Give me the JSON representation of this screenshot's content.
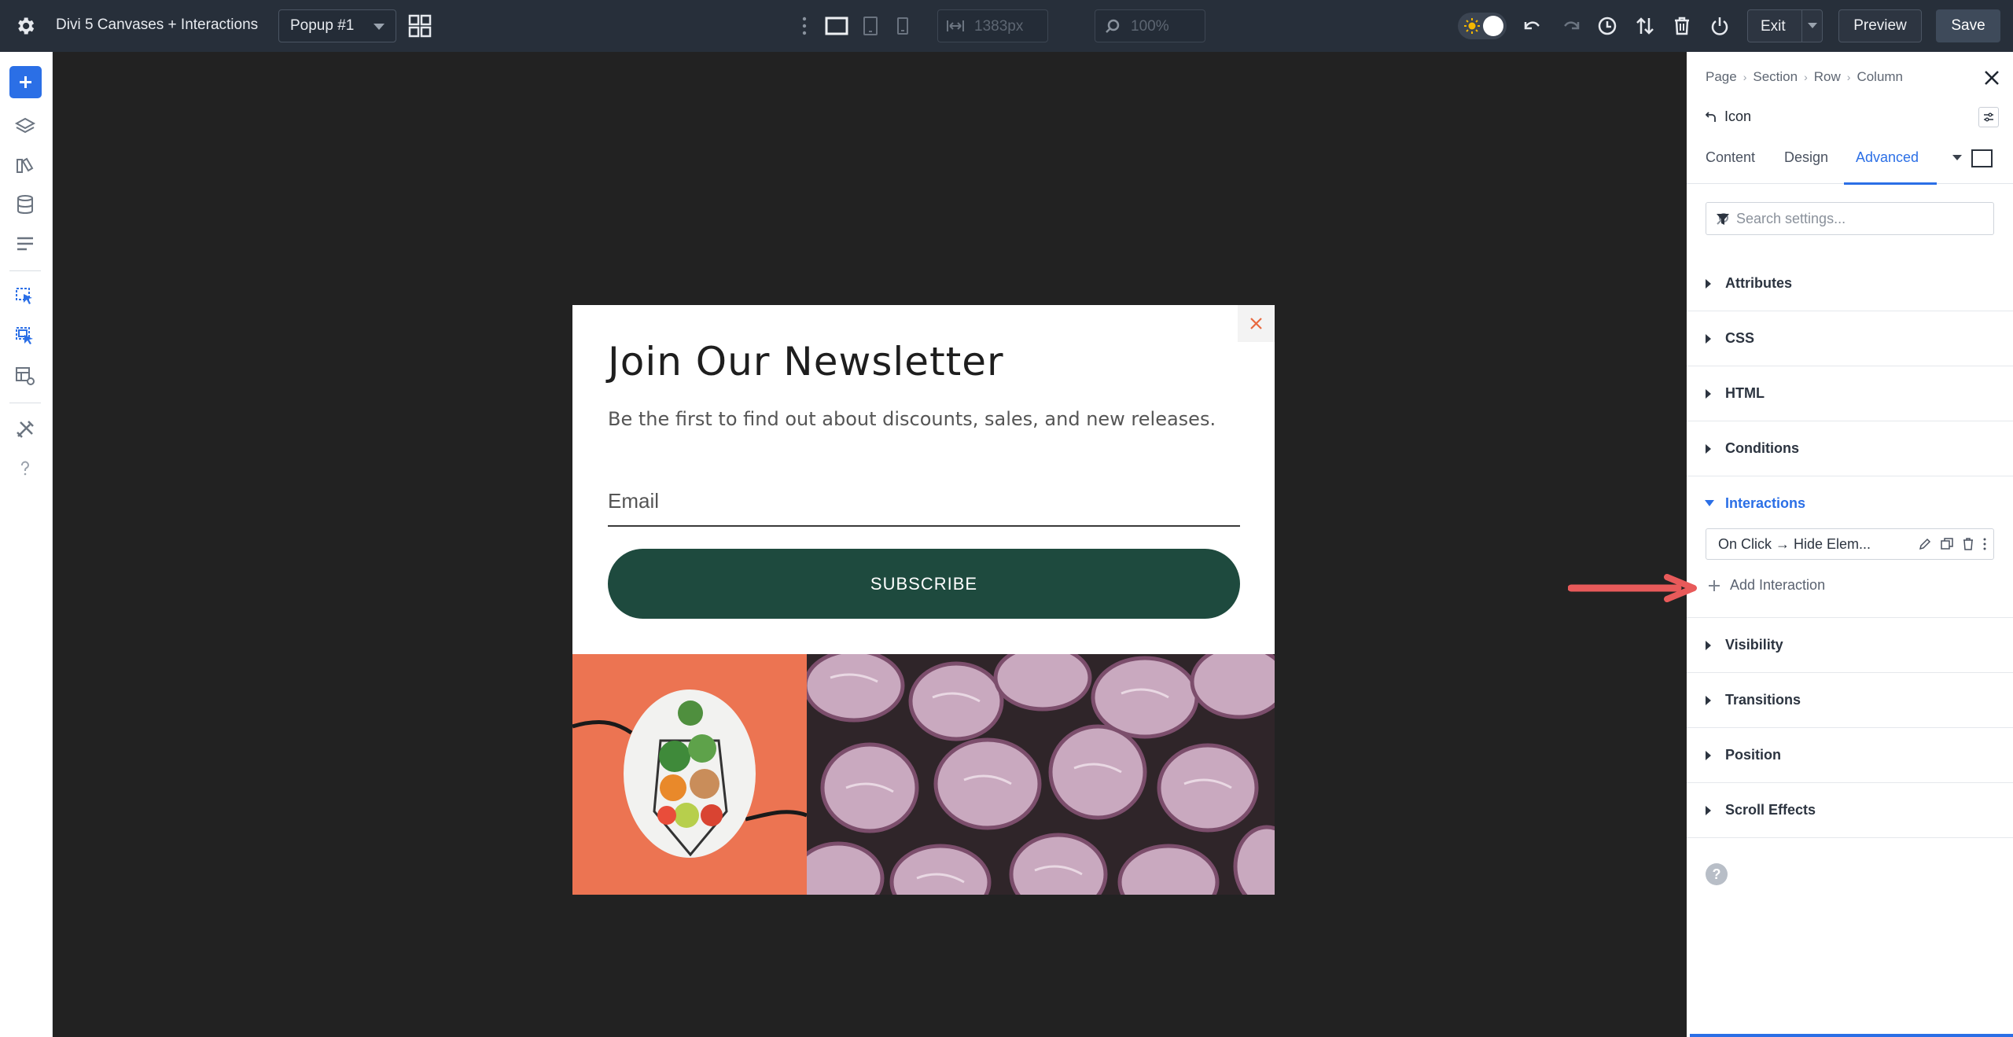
{
  "topbar": {
    "title": "Divi 5 Canvases + Interactions",
    "canvas_select": "Popup #1",
    "width_value": "1383px",
    "zoom_value": "100%",
    "exit_label": "Exit",
    "preview_label": "Preview",
    "save_label": "Save"
  },
  "popup": {
    "title": "Join Our Newsletter",
    "subtitle": "Be the first to find out about discounts, sales, and new releases.",
    "email_placeholder": "Email",
    "button_label": "SUBSCRIBE"
  },
  "panel": {
    "breadcrumbs": [
      "Page",
      "Section",
      "Row",
      "Column"
    ],
    "element_name": "Icon",
    "tabs": [
      "Content",
      "Design",
      "Advanced"
    ],
    "active_tab": "Advanced",
    "search_placeholder": "Search settings...",
    "sections": [
      {
        "label": "Attributes"
      },
      {
        "label": "CSS"
      },
      {
        "label": "HTML"
      },
      {
        "label": "Conditions"
      },
      {
        "label": "Interactions",
        "open": true
      },
      {
        "label": "Visibility"
      },
      {
        "label": "Transitions"
      },
      {
        "label": "Position"
      },
      {
        "label": "Scroll Effects"
      }
    ],
    "interaction_item": "On Click → Hide Elem...",
    "add_interaction_label": "Add Interaction"
  },
  "colors": {
    "accent": "#2b6fe6",
    "subscribe_button": "#1e4a3e",
    "popup_orange": "#ec7452",
    "annotation_arrow": "#e85a5a"
  }
}
